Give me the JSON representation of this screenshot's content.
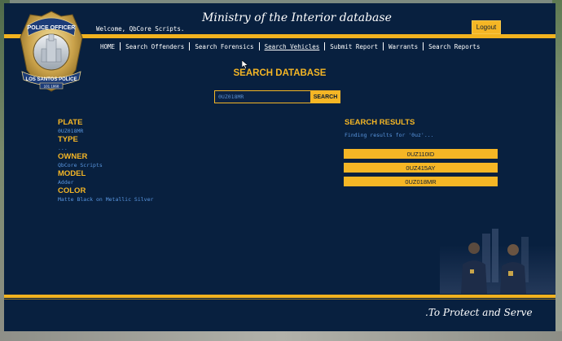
{
  "header": {
    "title": "Ministry of the Interior database",
    "welcome": "Welcome, QbCore Scripts.",
    "logout_label": "Logout"
  },
  "badge": {
    "top_text": "POLICE OFFICER",
    "bottom_text": "LOS SANTOS POLICE",
    "number": "101 1868"
  },
  "nav": {
    "items": [
      {
        "label": "HOME"
      },
      {
        "label": "Search Offenders"
      },
      {
        "label": "Search Forensics"
      },
      {
        "label": "Search Vehicles",
        "active": true
      },
      {
        "label": "Submit Report"
      },
      {
        "label": "Warrants"
      },
      {
        "label": "Search Reports"
      }
    ]
  },
  "search": {
    "heading": "SEARCH DATABASE",
    "value": "0UZ018MR",
    "button_label": "SEARCH"
  },
  "vehicle": {
    "plate_label": "PLATE",
    "plate": "0UZ018MR",
    "type_label": "TYPE",
    "type": "...",
    "owner_label": "OWNER",
    "owner": "QbCore Scripts",
    "model_label": "MODEL",
    "model": "Adder",
    "color_label": "COLOR",
    "color": "Matte Black on Metallic Silver"
  },
  "results": {
    "title": "SEARCH RESULTS",
    "status": "Finding results for '0uz'...",
    "items": [
      "0UZ110ID",
      "0UZ415AY",
      "0UZ018MR"
    ]
  },
  "footer": {
    "motto": ".To Protect and Serve"
  },
  "colors": {
    "panel": "#08203f",
    "accent": "#f5b625",
    "value_text": "#5a97e0"
  }
}
